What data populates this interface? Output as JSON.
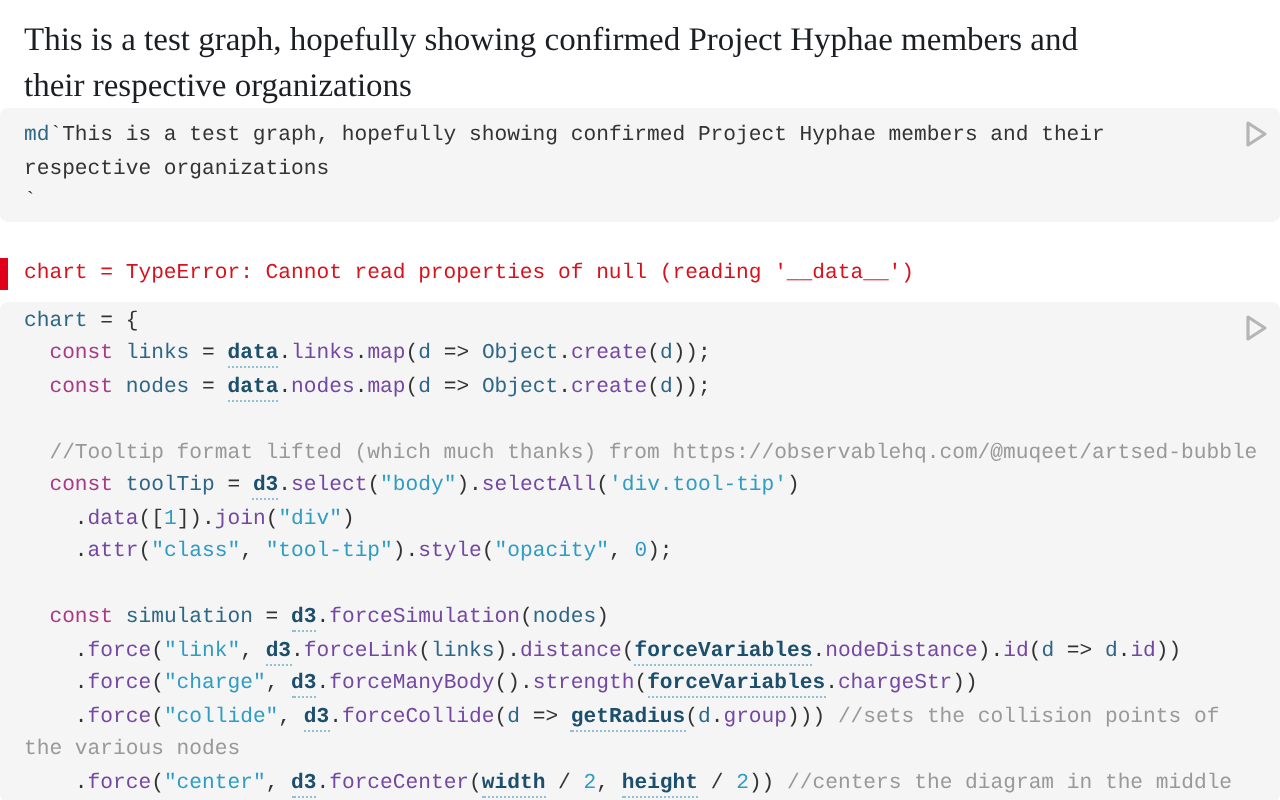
{
  "prose": {
    "text": "This is a test graph, hopefully showing confirmed Project Hyphae members and their respective organizations"
  },
  "cells": [
    {
      "kind": "source",
      "lines": [
        {
          "kind": "code",
          "tokens": [
            {
              "kind": "variable",
              "text": "md"
            },
            {
              "kind": "plain",
              "text": "`This is a test graph, hopefully showing confirmed Project Hyphae members and their"
            }
          ]
        },
        {
          "kind": "code",
          "tokens": [
            {
              "kind": "plain",
              "text": "respective organizations"
            }
          ]
        },
        {
          "kind": "code",
          "tokens": [
            {
              "kind": "plain",
              "text": "`"
            }
          ]
        }
      ]
    },
    {
      "kind": "error",
      "text": "chart = TypeError: Cannot read properties of null (reading '__data__')"
    },
    {
      "kind": "source",
      "lines": [
        {
          "kind": "code",
          "tokens": [
            {
              "kind": "variable",
              "text": "chart"
            },
            {
              "kind": "plain",
              "text": " = {"
            }
          ]
        },
        {
          "kind": "code",
          "tokens": [
            {
              "kind": "keyword",
              "text": "  const"
            },
            {
              "kind": "variable",
              "text": " links"
            },
            {
              "kind": "plain",
              "text": " = "
            },
            {
              "kind": "reference",
              "text": "data"
            },
            {
              "kind": "plain",
              "text": "."
            },
            {
              "kind": "property",
              "text": "links"
            },
            {
              "kind": "plain",
              "text": "."
            },
            {
              "kind": "property",
              "text": "map"
            },
            {
              "kind": "plain",
              "text": "("
            },
            {
              "kind": "variable",
              "text": "d"
            },
            {
              "kind": "plain",
              "text": " => "
            },
            {
              "kind": "variable",
              "text": "Object"
            },
            {
              "kind": "plain",
              "text": "."
            },
            {
              "kind": "property",
              "text": "create"
            },
            {
              "kind": "plain",
              "text": "("
            },
            {
              "kind": "variable",
              "text": "d"
            },
            {
              "kind": "plain",
              "text": "));"
            }
          ]
        },
        {
          "kind": "code",
          "tokens": [
            {
              "kind": "keyword",
              "text": "  const"
            },
            {
              "kind": "variable",
              "text": " nodes"
            },
            {
              "kind": "plain",
              "text": " = "
            },
            {
              "kind": "reference",
              "text": "data"
            },
            {
              "kind": "plain",
              "text": "."
            },
            {
              "kind": "property",
              "text": "nodes"
            },
            {
              "kind": "plain",
              "text": "."
            },
            {
              "kind": "property",
              "text": "map"
            },
            {
              "kind": "plain",
              "text": "("
            },
            {
              "kind": "variable",
              "text": "d"
            },
            {
              "kind": "plain",
              "text": " => "
            },
            {
              "kind": "variable",
              "text": "Object"
            },
            {
              "kind": "plain",
              "text": "."
            },
            {
              "kind": "property",
              "text": "create"
            },
            {
              "kind": "plain",
              "text": "("
            },
            {
              "kind": "variable",
              "text": "d"
            },
            {
              "kind": "plain",
              "text": "));"
            }
          ]
        },
        {
          "kind": "blank"
        },
        {
          "kind": "code",
          "tokens": [
            {
              "kind": "comment",
              "text": "  //Tooltip format lifted (which much thanks) from https://observablehq.com/@muqeet/artsed-bubble"
            }
          ]
        },
        {
          "kind": "code",
          "tokens": [
            {
              "kind": "keyword",
              "text": "  const"
            },
            {
              "kind": "variable",
              "text": " toolTip"
            },
            {
              "kind": "plain",
              "text": " = "
            },
            {
              "kind": "reference",
              "text": "d3"
            },
            {
              "kind": "plain",
              "text": "."
            },
            {
              "kind": "property",
              "text": "select"
            },
            {
              "kind": "plain",
              "text": "("
            },
            {
              "kind": "string",
              "text": "\"body\""
            },
            {
              "kind": "plain",
              "text": ")."
            },
            {
              "kind": "property",
              "text": "selectAll"
            },
            {
              "kind": "plain",
              "text": "("
            },
            {
              "kind": "string",
              "text": "'div.tool-tip'"
            },
            {
              "kind": "plain",
              "text": ")"
            }
          ]
        },
        {
          "kind": "code",
          "tokens": [
            {
              "kind": "plain",
              "text": "    ."
            },
            {
              "kind": "property",
              "text": "data"
            },
            {
              "kind": "plain",
              "text": "(["
            },
            {
              "kind": "number",
              "text": "1"
            },
            {
              "kind": "plain",
              "text": "])."
            },
            {
              "kind": "property",
              "text": "join"
            },
            {
              "kind": "plain",
              "text": "("
            },
            {
              "kind": "string",
              "text": "\"div\""
            },
            {
              "kind": "plain",
              "text": ")"
            }
          ]
        },
        {
          "kind": "code",
          "tokens": [
            {
              "kind": "plain",
              "text": "    ."
            },
            {
              "kind": "property",
              "text": "attr"
            },
            {
              "kind": "plain",
              "text": "("
            },
            {
              "kind": "string",
              "text": "\"class\""
            },
            {
              "kind": "plain",
              "text": ", "
            },
            {
              "kind": "string",
              "text": "\"tool-tip\""
            },
            {
              "kind": "plain",
              "text": ")."
            },
            {
              "kind": "property",
              "text": "style"
            },
            {
              "kind": "plain",
              "text": "("
            },
            {
              "kind": "string",
              "text": "\"opacity\""
            },
            {
              "kind": "plain",
              "text": ", "
            },
            {
              "kind": "number",
              "text": "0"
            },
            {
              "kind": "plain",
              "text": ");"
            }
          ]
        },
        {
          "kind": "blank"
        },
        {
          "kind": "code",
          "tokens": [
            {
              "kind": "keyword",
              "text": "  const"
            },
            {
              "kind": "variable",
              "text": " simulation"
            },
            {
              "kind": "plain",
              "text": " = "
            },
            {
              "kind": "reference",
              "text": "d3"
            },
            {
              "kind": "plain",
              "text": "."
            },
            {
              "kind": "property",
              "text": "forceSimulation"
            },
            {
              "kind": "plain",
              "text": "("
            },
            {
              "kind": "variable",
              "text": "nodes"
            },
            {
              "kind": "plain",
              "text": ")"
            }
          ]
        },
        {
          "kind": "code",
          "tokens": [
            {
              "kind": "plain",
              "text": "    ."
            },
            {
              "kind": "property",
              "text": "force"
            },
            {
              "kind": "plain",
              "text": "("
            },
            {
              "kind": "string",
              "text": "\"link\""
            },
            {
              "kind": "plain",
              "text": ", "
            },
            {
              "kind": "reference",
              "text": "d3"
            },
            {
              "kind": "plain",
              "text": "."
            },
            {
              "kind": "property",
              "text": "forceLink"
            },
            {
              "kind": "plain",
              "text": "("
            },
            {
              "kind": "variable",
              "text": "links"
            },
            {
              "kind": "plain",
              "text": ")."
            },
            {
              "kind": "property",
              "text": "distance"
            },
            {
              "kind": "plain",
              "text": "("
            },
            {
              "kind": "reference",
              "text": "forceVariables"
            },
            {
              "kind": "plain",
              "text": "."
            },
            {
              "kind": "property",
              "text": "nodeDistance"
            },
            {
              "kind": "plain",
              "text": ")."
            },
            {
              "kind": "property",
              "text": "id"
            },
            {
              "kind": "plain",
              "text": "("
            },
            {
              "kind": "variable",
              "text": "d"
            },
            {
              "kind": "plain",
              "text": " => "
            },
            {
              "kind": "variable",
              "text": "d"
            },
            {
              "kind": "plain",
              "text": "."
            },
            {
              "kind": "property",
              "text": "id"
            },
            {
              "kind": "plain",
              "text": "))"
            }
          ]
        },
        {
          "kind": "code",
          "tokens": [
            {
              "kind": "plain",
              "text": "    ."
            },
            {
              "kind": "property",
              "text": "force"
            },
            {
              "kind": "plain",
              "text": "("
            },
            {
              "kind": "string",
              "text": "\"charge\""
            },
            {
              "kind": "plain",
              "text": ", "
            },
            {
              "kind": "reference",
              "text": "d3"
            },
            {
              "kind": "plain",
              "text": "."
            },
            {
              "kind": "property",
              "text": "forceManyBody"
            },
            {
              "kind": "plain",
              "text": "()."
            },
            {
              "kind": "property",
              "text": "strength"
            },
            {
              "kind": "plain",
              "text": "("
            },
            {
              "kind": "reference",
              "text": "forceVariables"
            },
            {
              "kind": "plain",
              "text": "."
            },
            {
              "kind": "property",
              "text": "chargeStr"
            },
            {
              "kind": "plain",
              "text": "))"
            }
          ]
        },
        {
          "kind": "code",
          "tokens": [
            {
              "kind": "plain",
              "text": "    ."
            },
            {
              "kind": "property",
              "text": "force"
            },
            {
              "kind": "plain",
              "text": "("
            },
            {
              "kind": "string",
              "text": "\"collide\""
            },
            {
              "kind": "plain",
              "text": ", "
            },
            {
              "kind": "reference",
              "text": "d3"
            },
            {
              "kind": "plain",
              "text": "."
            },
            {
              "kind": "property",
              "text": "forceCollide"
            },
            {
              "kind": "plain",
              "text": "("
            },
            {
              "kind": "variable",
              "text": "d"
            },
            {
              "kind": "plain",
              "text": " => "
            },
            {
              "kind": "reference",
              "text": "getRadius"
            },
            {
              "kind": "plain",
              "text": "("
            },
            {
              "kind": "variable",
              "text": "d"
            },
            {
              "kind": "plain",
              "text": "."
            },
            {
              "kind": "property",
              "text": "group"
            },
            {
              "kind": "plain",
              "text": "))) "
            },
            {
              "kind": "comment",
              "text": "//sets the collision points of"
            }
          ]
        },
        {
          "kind": "code",
          "tokens": [
            {
              "kind": "comment",
              "text": "the various nodes"
            }
          ]
        },
        {
          "kind": "code",
          "tokens": [
            {
              "kind": "plain",
              "text": "    ."
            },
            {
              "kind": "property",
              "text": "force"
            },
            {
              "kind": "plain",
              "text": "("
            },
            {
              "kind": "string",
              "text": "\"center\""
            },
            {
              "kind": "plain",
              "text": ", "
            },
            {
              "kind": "reference",
              "text": "d3"
            },
            {
              "kind": "plain",
              "text": "."
            },
            {
              "kind": "property",
              "text": "forceCenter"
            },
            {
              "kind": "plain",
              "text": "("
            },
            {
              "kind": "reference",
              "text": "width"
            },
            {
              "kind": "plain",
              "text": " / "
            },
            {
              "kind": "number",
              "text": "2"
            },
            {
              "kind": "plain",
              "text": ", "
            },
            {
              "kind": "reference",
              "text": "height"
            },
            {
              "kind": "plain",
              "text": " / "
            },
            {
              "kind": "number",
              "text": "2"
            },
            {
              "kind": "plain",
              "text": ")) "
            },
            {
              "kind": "comment",
              "text": "//centers the diagram in the middle"
            }
          ]
        }
      ]
    }
  ]
}
